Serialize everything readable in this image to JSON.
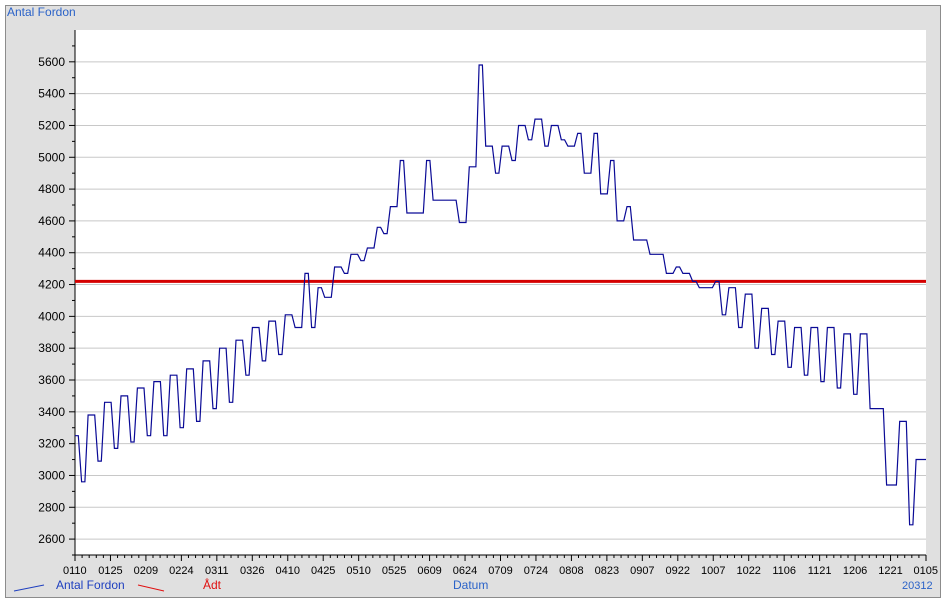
{
  "window": {
    "title": "Antal Fordon"
  },
  "legend": {
    "series_label": "Antal Fordon",
    "adt_label": "Ådt"
  },
  "footer": {
    "xlabel": "Datum",
    "extra": "20312"
  },
  "colors": {
    "series": "#0a0a96",
    "adt": "#d40000",
    "grid": "#c8c8c8",
    "plot_bg": "#ffffff",
    "frame_bg": "#e0e0e0",
    "text_blue": "#2a62c8"
  },
  "chart_data": {
    "type": "line",
    "title": "Antal Fordon",
    "xlabel": "Datum",
    "ylabel": "",
    "ylim": [
      2500,
      5800
    ],
    "yticks": [
      2600,
      2800,
      3000,
      3200,
      3400,
      3600,
      3800,
      4000,
      4200,
      4400,
      4600,
      4800,
      5000,
      5200,
      5400,
      5600
    ],
    "xticks": [
      "0110",
      "0125",
      "0209",
      "0224",
      "0311",
      "0326",
      "0410",
      "0425",
      "0510",
      "0525",
      "0609",
      "0624",
      "0709",
      "0724",
      "0808",
      "0823",
      "0907",
      "0922",
      "1007",
      "1022",
      "1106",
      "1121",
      "1206",
      "1221",
      "0105"
    ],
    "grid": true,
    "adt_value": 4220,
    "series": [
      {
        "name": "Antal Fordon",
        "values": [
          3250,
          3250,
          2960,
          2960,
          3380,
          3380,
          3380,
          3090,
          3090,
          3460,
          3460,
          3460,
          3170,
          3170,
          3500,
          3500,
          3500,
          3210,
          3210,
          3550,
          3550,
          3550,
          3250,
          3250,
          3590,
          3590,
          3590,
          3250,
          3250,
          3630,
          3630,
          3630,
          3300,
          3300,
          3670,
          3670,
          3670,
          3340,
          3340,
          3720,
          3720,
          3720,
          3420,
          3420,
          3800,
          3800,
          3800,
          3460,
          3460,
          3850,
          3850,
          3850,
          3630,
          3630,
          3930,
          3930,
          3930,
          3720,
          3720,
          3970,
          3970,
          3970,
          3760,
          3760,
          4010,
          4010,
          4010,
          3930,
          3930,
          3930,
          4270,
          4270,
          3930,
          3930,
          4180,
          4180,
          4120,
          4120,
          4120,
          4310,
          4310,
          4310,
          4270,
          4270,
          4390,
          4390,
          4390,
          4350,
          4350,
          4430,
          4430,
          4430,
          4560,
          4560,
          4520,
          4520,
          4690,
          4690,
          4690,
          4980,
          4980,
          4650,
          4650,
          4650,
          4650,
          4650,
          4650,
          4980,
          4980,
          4730,
          4730,
          4730,
          4730,
          4730,
          4730,
          4730,
          4730,
          4590,
          4590,
          4590,
          4940,
          4940,
          4940,
          5580,
          5580,
          5070,
          5070,
          5070,
          4900,
          4900,
          5070,
          5070,
          5070,
          4980,
          4980,
          5200,
          5200,
          5200,
          5110,
          5110,
          5240,
          5240,
          5240,
          5070,
          5070,
          5200,
          5200,
          5200,
          5110,
          5110,
          5070,
          5070,
          5070,
          5150,
          5150,
          4900,
          4900,
          4900,
          5150,
          5150,
          4770,
          4770,
          4770,
          4980,
          4980,
          4600,
          4600,
          4600,
          4690,
          4690,
          4480,
          4480,
          4480,
          4480,
          4480,
          4390,
          4390,
          4390,
          4390,
          4390,
          4270,
          4270,
          4270,
          4310,
          4310,
          4270,
          4270,
          4270,
          4220,
          4220,
          4180,
          4180,
          4180,
          4180,
          4180,
          4220,
          4220,
          4010,
          4010,
          4180,
          4180,
          4180,
          3930,
          3930,
          4140,
          4140,
          4140,
          3800,
          3800,
          4050,
          4050,
          4050,
          3760,
          3760,
          3970,
          3970,
          3970,
          3680,
          3680,
          3930,
          3930,
          3930,
          3630,
          3630,
          3930,
          3930,
          3930,
          3590,
          3590,
          3930,
          3930,
          3930,
          3550,
          3550,
          3890,
          3890,
          3890,
          3510,
          3510,
          3890,
          3890,
          3890,
          3420,
          3420,
          3420,
          3420,
          3420,
          2940,
          2940,
          2940,
          2940,
          3340,
          3340,
          3340,
          2690,
          2690,
          3100,
          3100,
          3100,
          3100
        ]
      }
    ]
  }
}
